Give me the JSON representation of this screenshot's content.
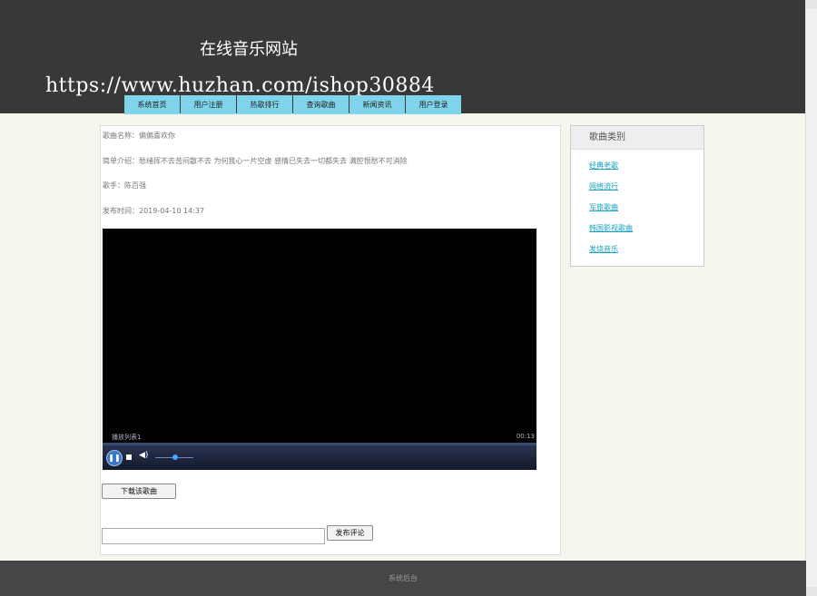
{
  "site": {
    "title": "在线音乐网站",
    "watermark": "https://www.huzhan.com/ishop30884"
  },
  "nav": {
    "items": [
      {
        "label": "系统首页"
      },
      {
        "label": "用户注册"
      },
      {
        "label": "热歌排行"
      },
      {
        "label": "查询歌曲"
      },
      {
        "label": "新闻资讯"
      },
      {
        "label": "用户登录"
      }
    ]
  },
  "song": {
    "name": "歌曲名称：偏偏喜欢你",
    "intro": "简单介绍：愁绪挥不去苦闷散不去 为何我心一片空虚 感情已失去一切都失去 满腔恨愁不可消除",
    "singer": "歌手：陈百强",
    "published": "发布时间：2019-04-10 14:37"
  },
  "player": {
    "playlist_label": "播放列表1",
    "time": "00:13",
    "play_icon": "pause-icon",
    "stop_icon": "stop-icon",
    "volume_icon": "speaker-icon"
  },
  "actions": {
    "download_label": "下载该歌曲",
    "comment_placeholder": "",
    "post_label": "发布评论"
  },
  "sidebar": {
    "title": "歌曲类别",
    "items": [
      {
        "label": "经典老歌"
      },
      {
        "label": "网络流行"
      },
      {
        "label": "军旅歌曲"
      },
      {
        "label": "韩国影视歌曲"
      },
      {
        "label": "发烧音乐"
      }
    ]
  },
  "footer": {
    "link": "系统后台"
  },
  "colors": {
    "header_bg": "#383838",
    "nav_bg": "#7fd3ea",
    "link": "#16a0bd",
    "page_bg": "#f6f5ee",
    "footer_bg": "#464646"
  }
}
